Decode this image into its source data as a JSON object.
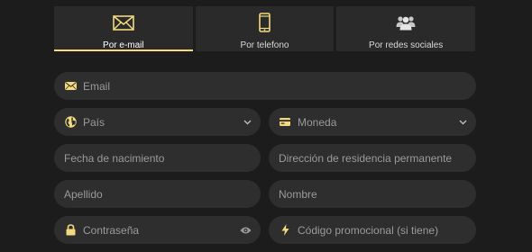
{
  "tabs": [
    {
      "label": "Por e-mail",
      "icon": "envelope-icon",
      "active": true
    },
    {
      "label": "Por telefono",
      "icon": "phone-icon",
      "active": false
    },
    {
      "label": "Por redes sociales",
      "icon": "users-icon",
      "active": false
    }
  ],
  "form": {
    "email_placeholder": "Email",
    "country_placeholder": "País",
    "currency_placeholder": "Moneda",
    "birthdate_placeholder": "Fecha de nacimiento",
    "address_placeholder": "Dirección de residencia permanente",
    "surname_placeholder": "Apellido",
    "name_placeholder": "Nombre",
    "password_placeholder": "Contraseña",
    "promo_placeholder": "Código promocional (si tiene)"
  },
  "colors": {
    "accent": "#f2d97a",
    "background": "#1c1c1c",
    "tab_bg": "#2a2a2a",
    "field_bg": "#2e2e2e",
    "placeholder_text": "#9a9a9a"
  }
}
